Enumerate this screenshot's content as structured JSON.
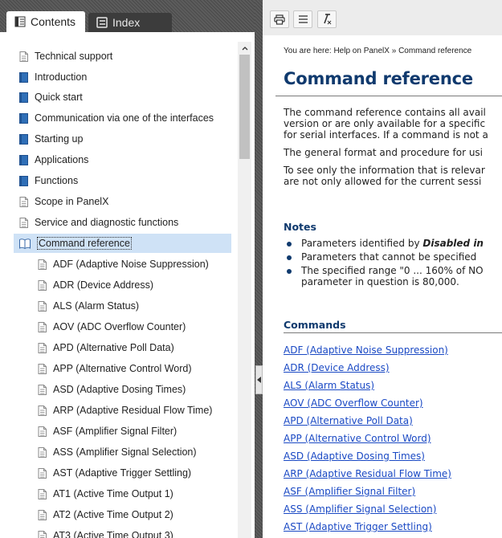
{
  "tabs": {
    "contents": "Contents",
    "index": "Index"
  },
  "toc": {
    "items": [
      {
        "label": "Technical support",
        "icon": "page-icon",
        "type": "page"
      },
      {
        "label": "Introduction",
        "icon": "book-closed-icon",
        "type": "book"
      },
      {
        "label": "Quick start",
        "icon": "book-closed-icon",
        "type": "book"
      },
      {
        "label": "Communication via one of the interfaces",
        "icon": "book-closed-icon",
        "type": "book"
      },
      {
        "label": "Starting up",
        "icon": "book-closed-icon",
        "type": "book"
      },
      {
        "label": "Applications",
        "icon": "book-closed-icon",
        "type": "book"
      },
      {
        "label": "Functions",
        "icon": "book-closed-icon",
        "type": "book"
      },
      {
        "label": "Scope in PanelX",
        "icon": "page-icon",
        "type": "page"
      },
      {
        "label": "Service and diagnostic functions",
        "icon": "page-icon",
        "type": "page"
      },
      {
        "label": "Command reference",
        "icon": "book-open-icon",
        "type": "open",
        "selected": true
      },
      {
        "label": "ADF (Adaptive Noise Suppression)",
        "icon": "page-icon",
        "type": "child"
      },
      {
        "label": "ADR (Device Address)",
        "icon": "page-icon",
        "type": "child"
      },
      {
        "label": "ALS (Alarm Status)",
        "icon": "page-icon",
        "type": "child"
      },
      {
        "label": "AOV (ADC Overflow Counter)",
        "icon": "page-icon",
        "type": "child"
      },
      {
        "label": "APD (Alternative Poll Data)",
        "icon": "page-icon",
        "type": "child"
      },
      {
        "label": "APP (Alternative Control Word)",
        "icon": "page-icon",
        "type": "child"
      },
      {
        "label": "ASD (Adaptive Dosing Times)",
        "icon": "page-icon",
        "type": "child"
      },
      {
        "label": "ARP (Adaptive Residual Flow Time)",
        "icon": "page-icon",
        "type": "child"
      },
      {
        "label": "ASF (Amplifier Signal Filter)",
        "icon": "page-icon",
        "type": "child"
      },
      {
        "label": "ASS (Amplifier Signal Selection)",
        "icon": "page-icon",
        "type": "child"
      },
      {
        "label": "AST (Adaptive Trigger Settling)",
        "icon": "page-icon",
        "type": "child"
      },
      {
        "label": "AT1 (Active Time Output 1)",
        "icon": "page-icon",
        "type": "child"
      },
      {
        "label": "AT2 (Active Time Output 2)",
        "icon": "page-icon",
        "type": "child"
      },
      {
        "label": "AT3 (Active Time Output 3)",
        "icon": "page-icon",
        "type": "child"
      }
    ]
  },
  "toolbar": {
    "print": "print-icon",
    "toggle_toc": "list-icon",
    "clear_highlight": "clear-format-icon"
  },
  "content": {
    "breadcrumb": "You are here: Help on PanelX » Command reference",
    "title": "Command reference",
    "paragraphs": [
      "The command reference contains all avail",
      "version or are only available for a specific",
      "for serial interfaces. If a command is not a",
      "The general format and procedure for usi",
      "To see only the information that is relevar",
      "are not only allowed for the current sessi"
    ],
    "notes_heading": "Notes",
    "notes": [
      {
        "prefix": "Parameters identified by ",
        "emphasis": "Disabled in",
        "suffix": ""
      },
      {
        "prefix": "Parameters that cannot be specified ",
        "emphasis": "",
        "suffix": ""
      },
      {
        "prefix": "The specified range \"0 ... 160% of NO",
        "emphasis": "",
        "suffix": ""
      }
    ],
    "notes_continuation": "parameter in question is 80,000.",
    "commands_heading": "Commands",
    "commands": [
      "ADF (Adaptive Noise Suppression)",
      "ADR (Device Address)",
      "ALS (Alarm Status)",
      "AOV (ADC Overflow Counter)",
      "APD (Alternative Poll Data)",
      "APP (Alternative Control Word)",
      "ASD (Adaptive Dosing Times)",
      "ARP (Adaptive Residual Flow Time)",
      "ASF (Amplifier Signal Filter)",
      "ASS (Amplifier Signal Selection)",
      "AST (Adaptive Trigger Settling)"
    ]
  },
  "colors": {
    "title": "#103a6e",
    "link": "#1a49c4",
    "selected_row": "#cfe2f6",
    "book_blue": "#2f6fb7"
  }
}
